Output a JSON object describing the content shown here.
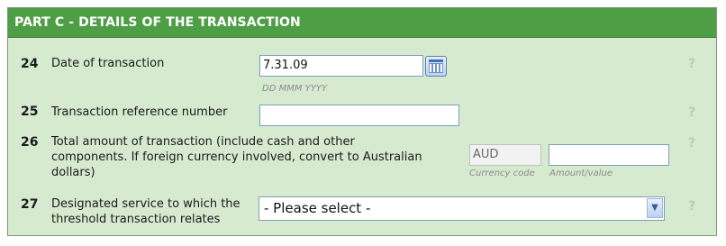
{
  "section": {
    "title": "PART C - DETAILS OF THE TRANSACTION"
  },
  "rows": [
    {
      "number": "24",
      "label": "Date of transaction",
      "value": "7.31.09",
      "hint": "DD MMM YYYY",
      "help": "?"
    },
    {
      "number": "25",
      "label": "Transaction reference number",
      "value": "",
      "help": "?"
    },
    {
      "number": "26",
      "label_lines": [
        "Total amount of transaction (include cash and other",
        "components. If foreign currency involved, convert to Australian",
        "dollars)"
      ],
      "currency_value": "AUD",
      "currency_hint": "Currency code",
      "amount_value": "",
      "amount_hint": "Amount/value",
      "help": "?"
    },
    {
      "number": "27",
      "label_lines": [
        "Designated service to which the",
        "threshold transaction relates"
      ],
      "selected": "- Please select -",
      "help": "?"
    }
  ],
  "icons": {
    "calendar": "calendar-icon",
    "dropdown": "chevron-down-icon",
    "help": "help-icon"
  },
  "colors": {
    "header_bg": "#4e9e46",
    "panel_bg": "#d6ead0",
    "border": "#7a9a74"
  }
}
